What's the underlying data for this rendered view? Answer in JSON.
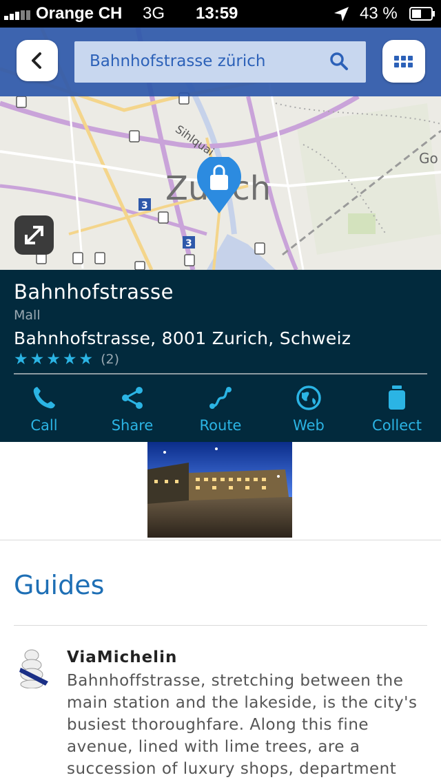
{
  "status_bar": {
    "carrier": "Orange CH",
    "network": "3G",
    "time": "13:59",
    "battery": "43 %"
  },
  "header": {
    "search_value": "Bahnhofstrasse zürich",
    "back_icon": "chevron-left-icon",
    "search_icon": "search-icon",
    "apps_icon": "grid-icon"
  },
  "map": {
    "labels": [
      "Zurich",
      "Sihlquai",
      "Go"
    ],
    "tram_lines": [
      "3",
      "3"
    ]
  },
  "place": {
    "name": "Bahnhofstrasse",
    "category": "Mall",
    "address": "Bahnhofstrasse, 8001 Zurich, Schweiz",
    "rating": 5,
    "review_count": "(2)"
  },
  "actions": [
    {
      "label": "Call",
      "icon": "phone-icon"
    },
    {
      "label": "Share",
      "icon": "share-icon"
    },
    {
      "label": "Route",
      "icon": "route-icon"
    },
    {
      "label": "Web",
      "icon": "globe-icon"
    },
    {
      "label": "Collect",
      "icon": "collect-icon"
    }
  ],
  "guides": {
    "title": "Guides",
    "items": [
      {
        "source": "ViaMichelin",
        "text": "Bahnhoffstrasse, stretching between the main station and the lakeside, is the city's busiest thoroughfare. Along this fine avenue, lined with lime trees, are a succession of luxury shops, department"
      }
    ]
  },
  "colors": {
    "header_blue": "#2e58aa",
    "panel_dark": "#022a3d",
    "accent_cyan": "#2bb4e4",
    "guides_blue": "#1e6fb5"
  }
}
